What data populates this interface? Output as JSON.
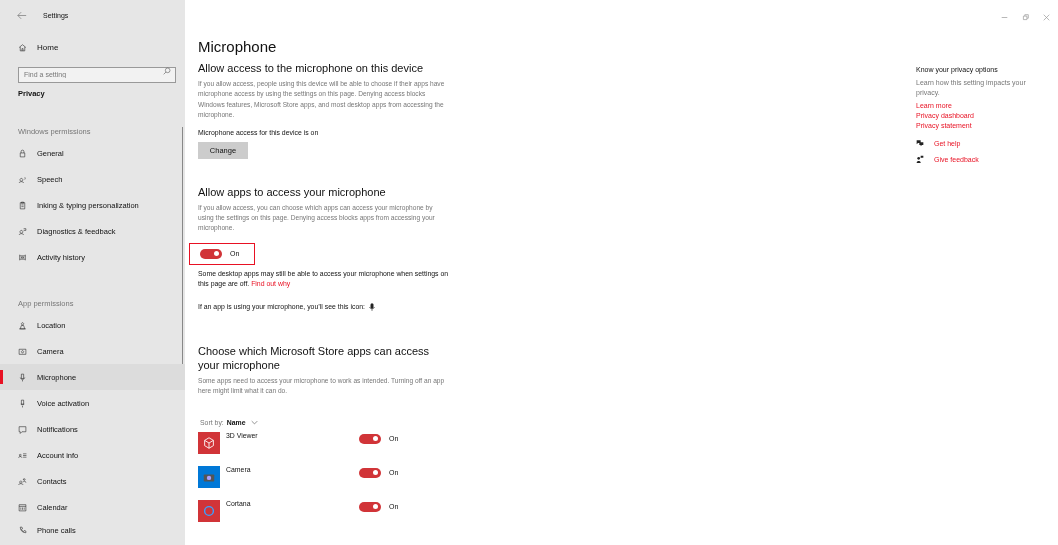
{
  "window": {
    "title": "Settings"
  },
  "sidebar": {
    "home": "Home",
    "search": {
      "placeholder": "Find a setting"
    },
    "category": "Privacy",
    "groups": [
      {
        "heading": "Windows permissions",
        "items": [
          {
            "label": "General",
            "selected": false
          },
          {
            "label": "Speech",
            "selected": false
          },
          {
            "label": "Inking & typing personalization",
            "selected": false
          },
          {
            "label": "Diagnostics & feedback",
            "selected": false
          },
          {
            "label": "Activity history",
            "selected": false
          }
        ]
      },
      {
        "heading": "App permissions",
        "items": [
          {
            "label": "Location",
            "selected": false
          },
          {
            "label": "Camera",
            "selected": false
          },
          {
            "label": "Microphone",
            "selected": true
          },
          {
            "label": "Voice activation",
            "selected": false
          },
          {
            "label": "Notifications",
            "selected": false
          },
          {
            "label": "Account info",
            "selected": false
          },
          {
            "label": "Contacts",
            "selected": false
          },
          {
            "label": "Calendar",
            "selected": false
          },
          {
            "label": "Phone calls",
            "selected": false
          }
        ]
      }
    ]
  },
  "main": {
    "title": "Microphone",
    "device_section": {
      "heading": "Allow access to the microphone on this device",
      "description": "If you allow access, people using this device will be able to choose if their apps have microphone access by using the settings on this page. Denying access blocks Windows features, Microsoft Store apps, and most desktop apps from accessing the microphone.",
      "status": "Microphone access for this device is on",
      "button": "Change"
    },
    "apps_section": {
      "heading": "Allow apps to access your microphone",
      "description": "If you allow access, you can choose which apps can access your microphone by using the settings on this page. Denying access blocks apps from accessing your microphone.",
      "toggle": {
        "on": true,
        "label": "On"
      },
      "note": "Some desktop apps may still be able to access your microphone when settings on this page are off.",
      "note_link": "Find out why",
      "icon_note": "If an app is using your microphone, you’ll see this icon:"
    },
    "store_section": {
      "heading": "Choose which Microsoft Store apps can access your microphone",
      "description": "Some apps need to access your microphone to work as intended. Turning off an app here might limit what it can do.",
      "sort_label": "Sort by:",
      "sort_value": "Name",
      "apps": [
        {
          "name": "3D Viewer",
          "color": "#d13438",
          "kind": "cube",
          "toggle": {
            "on": true,
            "label": "On"
          }
        },
        {
          "name": "Camera",
          "color": "#0078d7",
          "kind": "camera",
          "toggle": {
            "on": true,
            "label": "On"
          }
        },
        {
          "name": "Cortana",
          "color": "#d13438",
          "kind": "ring",
          "toggle": {
            "on": true,
            "label": "On"
          }
        }
      ]
    }
  },
  "aside": {
    "heading": "Know your privacy options",
    "description": "Learn how this setting impacts your privacy.",
    "links": [
      "Learn more",
      "Privacy dashboard",
      "Privacy statement"
    ],
    "help": "Get help",
    "feedback": "Give feedback"
  }
}
